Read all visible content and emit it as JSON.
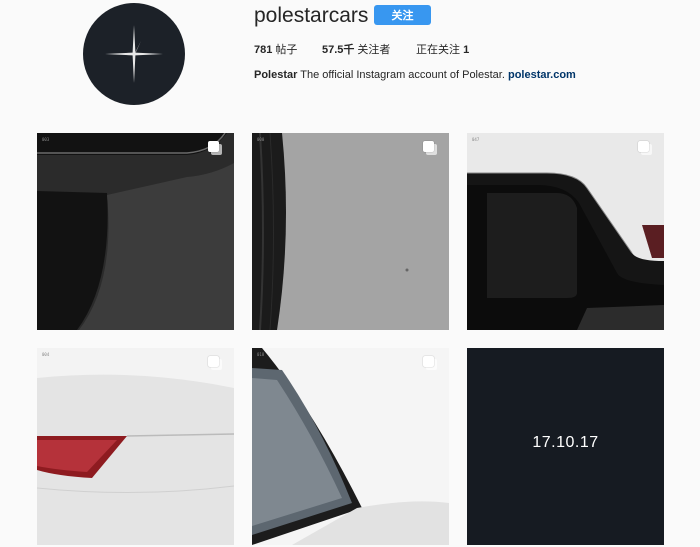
{
  "profile": {
    "username": "polestarcars",
    "follow_label": "关注",
    "stats": {
      "posts_count": "781",
      "posts_label": "帖子",
      "followers_count": "57.5千",
      "followers_label": "关注者",
      "following_label": "正在关注",
      "following_count": "1"
    },
    "bio": {
      "name": "Polestar",
      "text": "The official Instagram account of Polestar.",
      "link": "polestar.com"
    }
  },
  "posts": [
    {
      "number": "003",
      "multi": true
    },
    {
      "number": "000",
      "multi": true
    },
    {
      "number": "047",
      "multi": true
    },
    {
      "number": "004",
      "multi": true
    },
    {
      "number": "018",
      "multi": true
    },
    {
      "date_text": "17.10.17",
      "multi": false
    }
  ],
  "colors": {
    "follow_button": "#3897f0",
    "avatar_bg": "#1c2128",
    "link": "#003569"
  }
}
